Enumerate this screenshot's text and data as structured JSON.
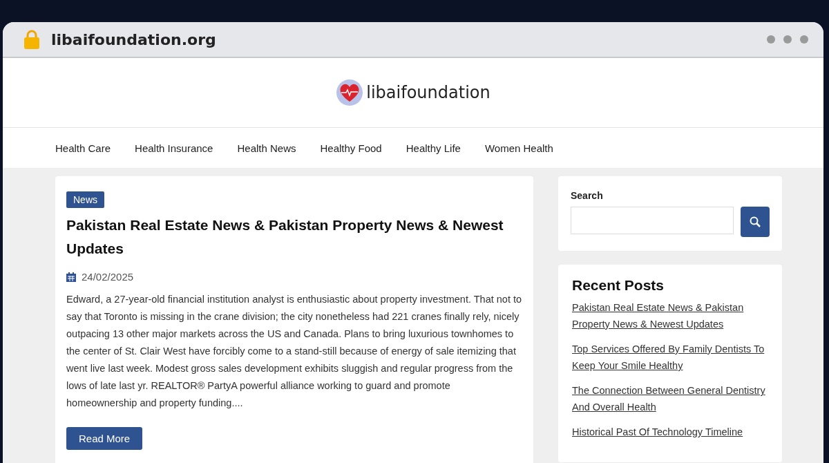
{
  "browser": {
    "url": "libaifoundation.org"
  },
  "site": {
    "name": "libaifoundation"
  },
  "nav": [
    {
      "label": "Health Care"
    },
    {
      "label": "Health Insurance"
    },
    {
      "label": "Health News"
    },
    {
      "label": "Healthy Food"
    },
    {
      "label": "Healthy Life"
    },
    {
      "label": "Women Health"
    }
  ],
  "article": {
    "category": "News",
    "title": "Pakistan Real Estate News & Pakistan Property News & Newest Updates",
    "date": "24/02/2025",
    "excerpt": "Edward, a 27-year-old financial institution analyst is enthusiastic about property investment. That not to say that Toronto is missing in the crane division; the city nonetheless had 221 cranes finally rely, nicely outpacing 13 other major markets across the US and Canada. Plans to bring luxurious townhomes to the center of St. Clair West have forcibly come to a stand-still because of energy of sale itemizing that went live last week. Modest gross sales development exhibits sluggish and regular progress from the lows of late last yr. REALTOR® PartyA powerful alliance working to guard and promote homeownership and property funding....",
    "button": "Read More"
  },
  "search": {
    "label": "Search"
  },
  "recent_posts": {
    "title": "Recent Posts",
    "items": [
      "Pakistan Real Estate News & Pakistan Property News & Newest Updates",
      "Top Services Offered By Family Dentists To Keep Your Smile Healthy",
      "The Connection Between General Dentistry And Overall Health",
      "Historical Past Of Technology Timeline"
    ]
  }
}
